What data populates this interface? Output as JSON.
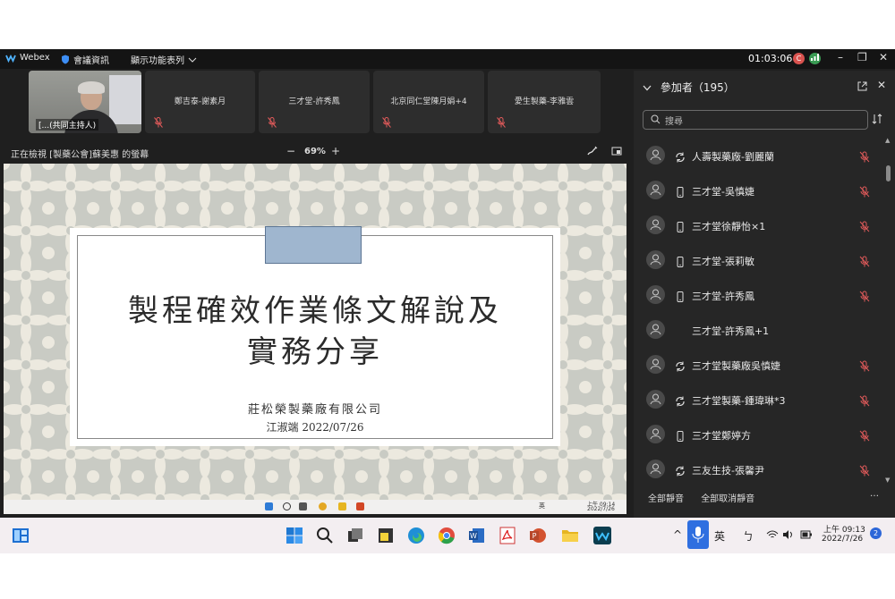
{
  "titlebar": {
    "app_name": "Webex",
    "meeting_info": "會議資訊",
    "show_menu": "顯示功能表列",
    "timer": "01:03:06",
    "badge_letter": "C"
  },
  "video_strip": {
    "self_label": "[...(共同主持人)",
    "tiles": [
      "鄭吉泰-謝素月",
      "三才堂-許秀鳳",
      "北京同仁堂陳月娟+4",
      "愛生製藥-李雅雲"
    ]
  },
  "share_header": {
    "viewing_label": "正在檢視 [製藥公會]蘇美惠 的螢幕",
    "zoom_minus": "−",
    "zoom": "69%",
    "zoom_plus": "+"
  },
  "slide": {
    "title_line1": "製程確效作業條文解說及",
    "title_line2": "實務分享",
    "company": "莊松榮製藥廠有限公司",
    "author": "江淑端 2022/07/26",
    "taskbar_ime": "英",
    "taskbar_time": "上午 09:14",
    "taskbar_date": "2022/7/26"
  },
  "participants": {
    "title": "參加者（195）",
    "search_placeholder": "搜尋",
    "list": [
      {
        "name": "人壽製藥廠-劉麗蘭",
        "device": "sync",
        "muted": true
      },
      {
        "name": "三才堂-吳慎婕",
        "device": "phone",
        "muted": true
      },
      {
        "name": "三才堂徐靜怡×1",
        "device": "phone",
        "muted": true
      },
      {
        "name": "三才堂-張莉敏",
        "device": "phone",
        "muted": true
      },
      {
        "name": "三才堂-許秀鳳",
        "device": "phone",
        "muted": true
      },
      {
        "name": "三才堂-許秀鳳+1",
        "device": "none",
        "muted": false
      },
      {
        "name": "三才堂製藥廠吳慎婕",
        "device": "sync",
        "muted": true
      },
      {
        "name": "三才堂製藥-鍾瑋琳*3",
        "device": "sync",
        "muted": true
      },
      {
        "name": "三才堂鄭婷方",
        "device": "phone",
        "muted": true
      },
      {
        "name": "三友生技-張馨尹",
        "device": "sync",
        "muted": true
      }
    ],
    "mute_all": "全部靜音",
    "unmute_all": "全部取消靜音",
    "more": "…"
  },
  "taskbar": {
    "ime": "英",
    "ime2": "ㄅ",
    "time": "上午 09:13",
    "date": "2022/7/26",
    "notif_count": "2"
  },
  "colors": {
    "accent": "#1d5fd1",
    "mute_red": "#e05a5a",
    "slide_bg": "#c9cbc4",
    "slide_tab": "#9fb6cf"
  }
}
